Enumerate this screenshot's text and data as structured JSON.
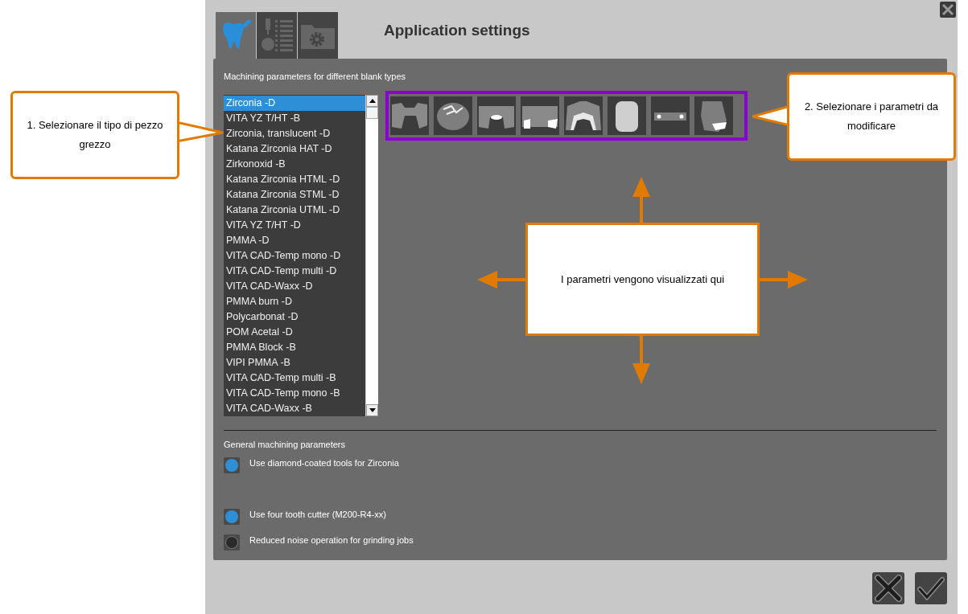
{
  "window": {
    "title": "Application settings"
  },
  "tabs": [
    {
      "kind": "tooth",
      "selected": true
    },
    {
      "kind": "tool-list",
      "selected": false
    },
    {
      "kind": "folder-gear",
      "selected": false
    }
  ],
  "blank_types": {
    "label": "Machining parameters for different blank types",
    "items": [
      {
        "name": "Zirconia -D",
        "selected": true
      },
      {
        "name": "VITA YZ  T/HT -B",
        "selected": false
      },
      {
        "name": "Zirconia, translucent -D",
        "selected": false
      },
      {
        "name": "Katana Zirconia HAT -D",
        "selected": false
      },
      {
        "name": "Zirkonoxid -B",
        "selected": false
      },
      {
        "name": "Katana Zirconia HTML -D",
        "selected": false
      },
      {
        "name": "Katana Zirconia STML -D",
        "selected": false
      },
      {
        "name": "Katana Zirconia UTML -D",
        "selected": false
      },
      {
        "name": "VITA YZ  T/HT -D",
        "selected": false
      },
      {
        "name": "PMMA -D",
        "selected": false
      },
      {
        "name": "VITA CAD-Temp mono -D",
        "selected": false
      },
      {
        "name": "VITA CAD-Temp multi -D",
        "selected": false
      },
      {
        "name": "VITA CAD-Waxx -D",
        "selected": false
      },
      {
        "name": "PMMA burn -D",
        "selected": false
      },
      {
        "name": "Polycarbonat -D",
        "selected": false
      },
      {
        "name": "POM Acetal -D",
        "selected": false
      },
      {
        "name": "PMMA Block -B",
        "selected": false
      },
      {
        "name": "VIPI PMMA -B",
        "selected": false
      },
      {
        "name": "VITA CAD-Temp multi -B",
        "selected": false
      },
      {
        "name": "VITA CAD-Temp mono -B",
        "selected": false
      },
      {
        "name": "VITA CAD-Waxx -B",
        "selected": false
      }
    ]
  },
  "general": {
    "label": "General machining parameters",
    "options": [
      {
        "label": "Use diamond-coated tools for Zirconia",
        "checked": true
      },
      {
        "label": "Use four tooth cutter (M200-R4-xx)",
        "checked": true
      },
      {
        "label": "Reduced noise operation for grinding jobs",
        "checked": false
      }
    ]
  },
  "callouts": [
    {
      "text": "1. Selezionare il tipo di pezzo grezzo"
    },
    {
      "text": "2. Selezionare i parametri da modificare"
    }
  ],
  "center_note": "I parametri vengono visualizzati qui"
}
